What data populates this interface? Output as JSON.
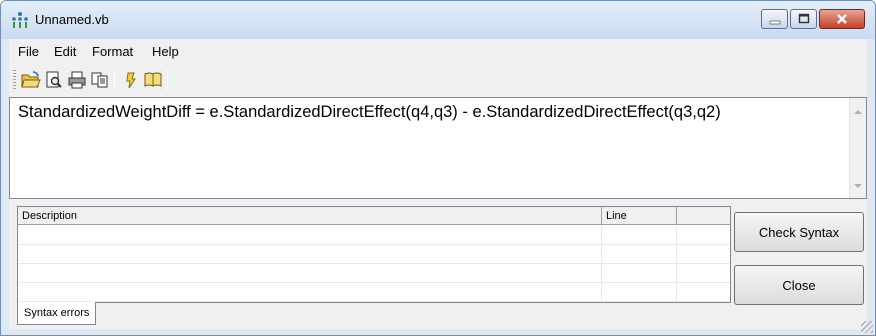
{
  "window": {
    "title": "Unnamed.vb",
    "accent": "#c4402a"
  },
  "menu": {
    "items": [
      "File",
      "Edit",
      "Format",
      "Help"
    ]
  },
  "toolbar": {
    "icons": [
      "open-folder-icon",
      "print-preview-icon",
      "print-icon",
      "copy-icon",
      "syntax-hint-icon",
      "book-icon"
    ]
  },
  "editor": {
    "code": "StandardizedWeightDiff = e.StandardizedDirectEffect(q4,q3) - e.StandardizedDirectEffect(q3,q2)"
  },
  "errors": {
    "columns": [
      "Description",
      "Line"
    ],
    "rows": [],
    "tab_label": "Syntax errors"
  },
  "buttons": {
    "check_syntax": "Check Syntax",
    "close": "Close"
  }
}
